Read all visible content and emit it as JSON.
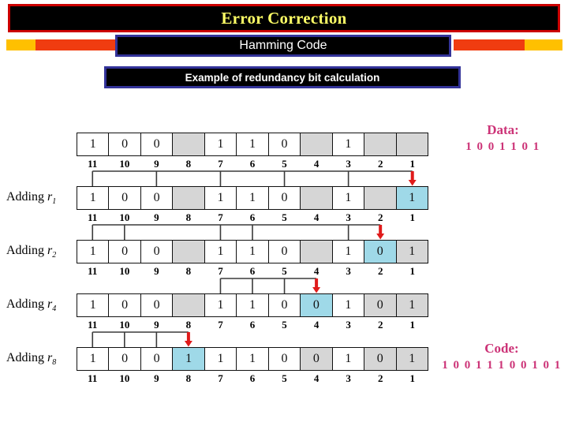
{
  "header": {
    "title": "Error Correction",
    "subtitle": "Hamming Code",
    "subsubtitle": "Example of redundancy bit calculation",
    "title_color": "#ffff66",
    "title_border_color": "#cc0000",
    "banner_border_color": "#333399",
    "deco_gold": "#ffc000",
    "deco_orange": "#f03c10"
  },
  "legend": {
    "data_label": "Data:",
    "data_bits": "1 0 0 1 1 0 1",
    "code_label": "Code:",
    "code_bits": "1 0 0 1 1 1 0 0 1 0 1",
    "text_color": "#cc3377"
  },
  "positions": [
    "11",
    "10",
    "9",
    "8",
    "7",
    "6",
    "5",
    "4",
    "3",
    "2",
    "1"
  ],
  "colors": {
    "highlight_cyan": "#9fd9e8",
    "empty_gray": "#d6d6d6",
    "arrow_red": "#e01b1b"
  },
  "rows": [
    {
      "label": "",
      "label_sub": "",
      "cells": [
        {
          "v": "1",
          "state": "filled"
        },
        {
          "v": "0",
          "state": "filled"
        },
        {
          "v": "0",
          "state": "filled"
        },
        {
          "v": "",
          "state": "gray"
        },
        {
          "v": "1",
          "state": "filled"
        },
        {
          "v": "1",
          "state": "filled"
        },
        {
          "v": "0",
          "state": "filled"
        },
        {
          "v": "",
          "state": "gray"
        },
        {
          "v": "1",
          "state": "filled"
        },
        {
          "v": "",
          "state": "gray"
        },
        {
          "v": "",
          "state": "gray"
        }
      ],
      "connector_taps": [],
      "arrow_at": null
    },
    {
      "label": "Adding r",
      "label_sub": "1",
      "cells": [
        {
          "v": "1",
          "state": "filled"
        },
        {
          "v": "0",
          "state": "filled"
        },
        {
          "v": "0",
          "state": "filled"
        },
        {
          "v": "",
          "state": "gray"
        },
        {
          "v": "1",
          "state": "filled"
        },
        {
          "v": "1",
          "state": "filled"
        },
        {
          "v": "0",
          "state": "filled"
        },
        {
          "v": "",
          "state": "gray"
        },
        {
          "v": "1",
          "state": "filled"
        },
        {
          "v": "",
          "state": "gray"
        },
        {
          "v": "1",
          "state": "cyan"
        }
      ],
      "connector_taps": [
        11,
        9,
        7,
        5,
        3
      ],
      "arrow_at": 1
    },
    {
      "label": "Adding r",
      "label_sub": "2",
      "cells": [
        {
          "v": "1",
          "state": "filled"
        },
        {
          "v": "0",
          "state": "filled"
        },
        {
          "v": "0",
          "state": "filled"
        },
        {
          "v": "",
          "state": "gray"
        },
        {
          "v": "1",
          "state": "filled"
        },
        {
          "v": "1",
          "state": "filled"
        },
        {
          "v": "0",
          "state": "filled"
        },
        {
          "v": "",
          "state": "gray"
        },
        {
          "v": "1",
          "state": "filled"
        },
        {
          "v": "0",
          "state": "cyan"
        },
        {
          "v": "1",
          "state": "gray"
        }
      ],
      "connector_taps": [
        11,
        10,
        7,
        6,
        3
      ],
      "arrow_at": 2
    },
    {
      "label": "Adding r",
      "label_sub": "4",
      "cells": [
        {
          "v": "1",
          "state": "filled"
        },
        {
          "v": "0",
          "state": "filled"
        },
        {
          "v": "0",
          "state": "filled"
        },
        {
          "v": "",
          "state": "gray"
        },
        {
          "v": "1",
          "state": "filled"
        },
        {
          "v": "1",
          "state": "filled"
        },
        {
          "v": "0",
          "state": "filled"
        },
        {
          "v": "0",
          "state": "cyan"
        },
        {
          "v": "1",
          "state": "filled"
        },
        {
          "v": "0",
          "state": "gray"
        },
        {
          "v": "1",
          "state": "gray"
        }
      ],
      "connector_taps": [
        7,
        6,
        5
      ],
      "arrow_at": 4
    },
    {
      "label": "Adding r",
      "label_sub": "8",
      "cells": [
        {
          "v": "1",
          "state": "filled"
        },
        {
          "v": "0",
          "state": "filled"
        },
        {
          "v": "0",
          "state": "filled"
        },
        {
          "v": "1",
          "state": "cyan"
        },
        {
          "v": "1",
          "state": "filled"
        },
        {
          "v": "1",
          "state": "filled"
        },
        {
          "v": "0",
          "state": "filled"
        },
        {
          "v": "0",
          "state": "gray"
        },
        {
          "v": "1",
          "state": "filled"
        },
        {
          "v": "0",
          "state": "gray"
        },
        {
          "v": "1",
          "state": "gray"
        }
      ],
      "connector_taps": [
        11,
        10,
        9
      ],
      "arrow_at": 8
    }
  ]
}
